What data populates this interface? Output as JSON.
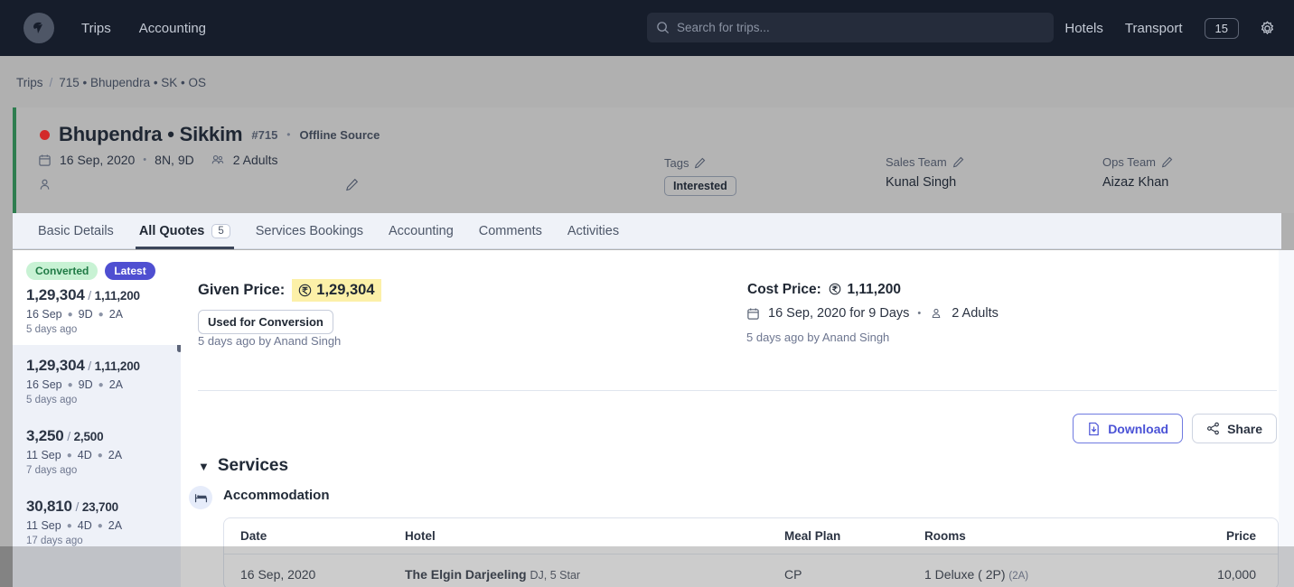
{
  "topnav": {
    "logo_name": "company-logo",
    "links": [
      "Trips",
      "Accounting"
    ],
    "search_placeholder": "Search for trips...",
    "search_value": "",
    "right_links": [
      "Hotels",
      "Transport"
    ],
    "count_badge": "15"
  },
  "breadcrumb": {
    "root": "Trips",
    "sep": "/",
    "current": "715 • Bhupendra • SK • OS"
  },
  "trip": {
    "title": "Bhupendra • Sikkim",
    "id": "#715",
    "sep": "•",
    "source": "Offline Source",
    "date": "16 Sep, 2020",
    "meta_sep": "•",
    "duration": "8N, 9D",
    "pax": "2 Adults",
    "traveller_name": "",
    "tags_label": "Tags",
    "tag": "Interested",
    "sales_team_label": "Sales Team",
    "sales_team": "Kunal Singh",
    "ops_team_label": "Ops Team",
    "ops_team": "Aizaz Khan"
  },
  "tabs": [
    {
      "label": "Basic Details",
      "count": "",
      "active": false
    },
    {
      "label": "All Quotes",
      "count": "5",
      "active": true
    },
    {
      "label": "Services Bookings",
      "count": "",
      "active": false
    },
    {
      "label": "Accounting",
      "count": "",
      "active": false
    },
    {
      "label": "Comments",
      "count": "",
      "active": false
    },
    {
      "label": "Activities",
      "count": "",
      "active": false
    }
  ],
  "quotes": [
    {
      "badges": [
        "Converted",
        "Latest"
      ],
      "given": "1,29,304",
      "slash": "/",
      "cost": "1,11,200",
      "date": "16 Sep",
      "days": "9D",
      "pax": "2A",
      "time": "5 days ago",
      "selected": true
    },
    {
      "badges": [],
      "given": "1,29,304",
      "slash": "/",
      "cost": "1,11,200",
      "date": "16 Sep",
      "days": "9D",
      "pax": "2A",
      "time": "5 days ago",
      "selected": false
    },
    {
      "badges": [],
      "given": "3,250",
      "slash": "/",
      "cost": "2,500",
      "date": "11 Sep",
      "days": "4D",
      "pax": "2A",
      "time": "7 days ago",
      "selected": false
    },
    {
      "badges": [],
      "given": "30,810",
      "slash": "/",
      "cost": "23,700",
      "date": "11 Sep",
      "days": "4D",
      "pax": "2A",
      "time": "17 days ago",
      "selected": false
    }
  ],
  "quote_detail": {
    "given_price_label": "Given Price:",
    "given_price_value": "1,29,304",
    "currency_symbol": "₹",
    "conversion_pill": "Used for Conversion",
    "given_byline": "5 days ago by Anand Singh",
    "cost_price_label": "Cost Price:",
    "cost_price_value": "1,11,200",
    "cost_date": "16 Sep, 2020 for 9 Days",
    "cost_sep": "•",
    "cost_pax": "2 Adults",
    "cost_byline": "5 days ago by Anand Singh",
    "download_label": "Download",
    "share_label": "Share",
    "services_title": "Services",
    "services_caret": "▼",
    "accommodation_title": "Accommodation"
  },
  "accommodation_table": {
    "columns": [
      "Date",
      "Hotel",
      "Meal Plan",
      "Rooms",
      "Price"
    ],
    "rows": [
      {
        "date": "16 Sep, 2020",
        "hotel_name": "The Elgin Darjeeling",
        "hotel_sub": "DJ, 5 Star",
        "meal_plan": "CP",
        "rooms": "1 Deluxe ( 2P)",
        "rooms_sub": "(2A)",
        "price": "10,000"
      }
    ]
  },
  "colors": {
    "topnav_bg": "#161d2b",
    "accent_green": "#2e7d4f",
    "badge_converted_bg": "#c8f2d4",
    "badge_latest_bg": "#4f4fd1",
    "highlight_yellow": "#fcf0a8",
    "download_blue": "#4a52d6",
    "status_dot_red": "#d32a2a"
  }
}
